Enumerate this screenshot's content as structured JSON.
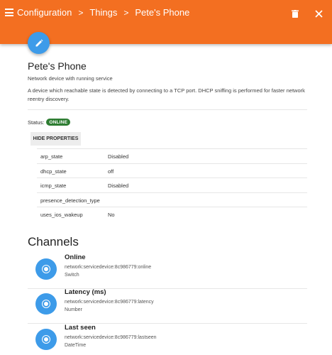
{
  "breadcrumb": {
    "items": [
      "Configuration",
      "Things",
      "Pete's Phone"
    ],
    "separator": ">"
  },
  "thing": {
    "title": "Pete's Phone",
    "subtitle": "Network device with running service",
    "description": "A device which reachable state is detected by connecting to a TCP port. DHCP sniffing is performed for faster network reentry discovery.",
    "status_label": "Status:",
    "status_value": "ONLINE",
    "toggle_properties_label": "HIDE PROPERTIES"
  },
  "properties": [
    {
      "key": "arp_state",
      "value": "Disabled"
    },
    {
      "key": "dhcp_state",
      "value": "off"
    },
    {
      "key": "icmp_state",
      "value": "Disabled"
    },
    {
      "key": "presence_detection_type",
      "value": ""
    },
    {
      "key": "uses_ios_wakeup",
      "value": "No"
    }
  ],
  "channels_heading": "Channels",
  "channels": [
    {
      "name": "Online",
      "uid": "network:servicedevice:8c986779:online",
      "type": "Switch"
    },
    {
      "name": "Latency (ms)",
      "uid": "network:servicedevice:8c986779:latency",
      "type": "Number"
    },
    {
      "name": "Last seen",
      "uid": "network:servicedevice:8c986779:lastseen",
      "type": "DateTime"
    }
  ],
  "colors": {
    "appbar": "#f36f21",
    "accent_blue": "#3d9be9",
    "status_online": "#2e7d32"
  },
  "icons": {
    "menu": "menu-icon",
    "delete": "trash-icon",
    "close": "close-icon",
    "edit": "pencil-icon",
    "channel": "radio-channel-icon"
  }
}
